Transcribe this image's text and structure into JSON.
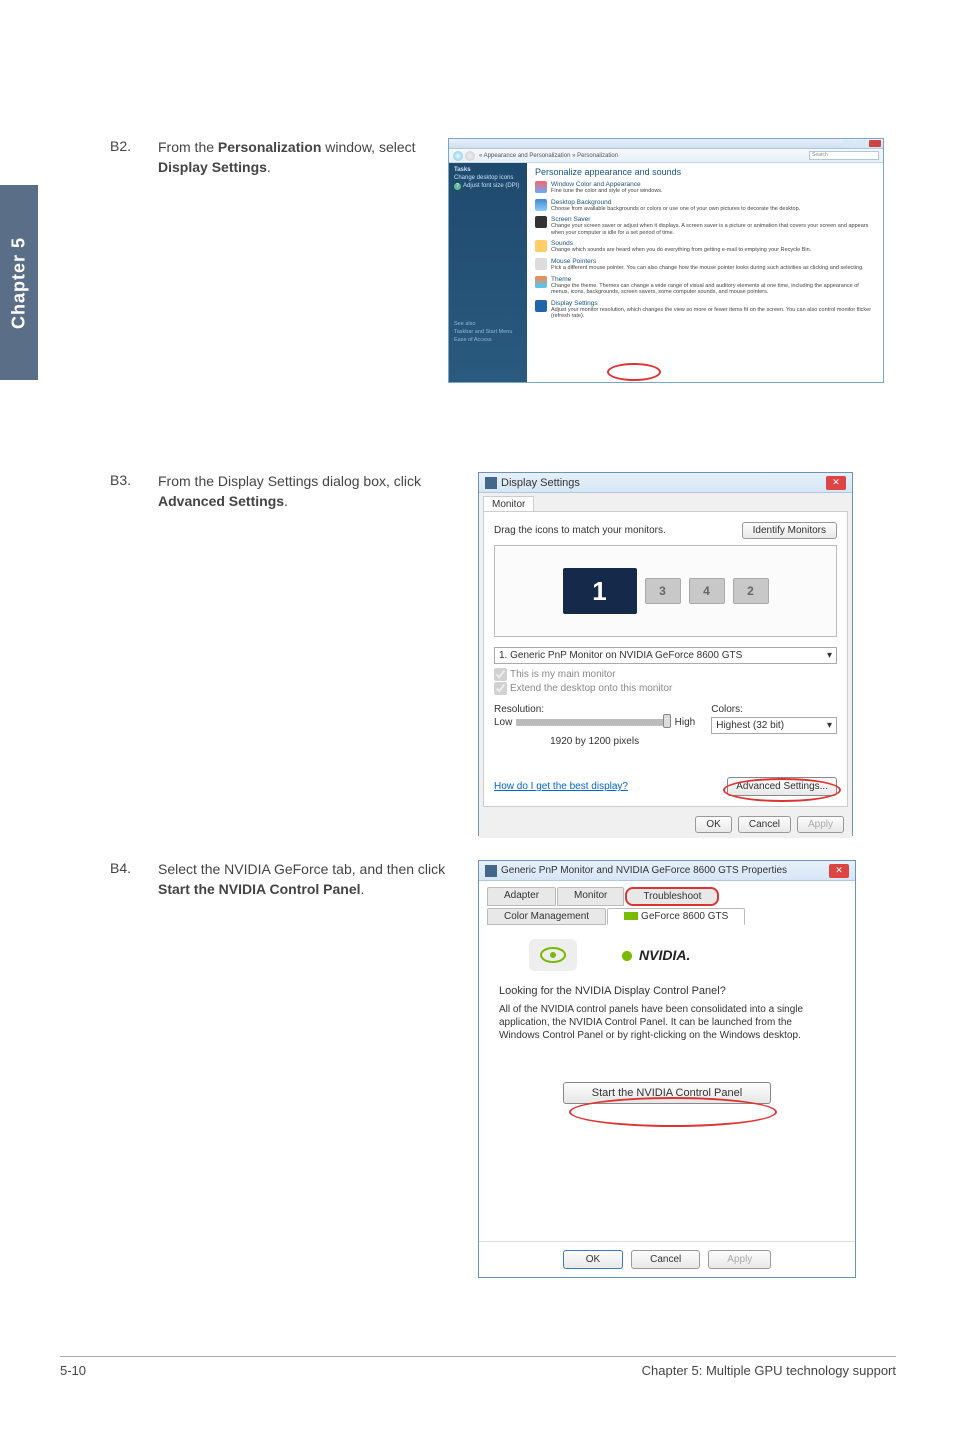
{
  "chapter_tab": "Chapter 5",
  "steps": {
    "b2": {
      "label": "B2.",
      "text_pre": "From the ",
      "text_bold1": "Personalization",
      "text_mid": " window, select ",
      "text_bold2": "Display Settings",
      "text_end": "."
    },
    "b3": {
      "label": "B3.",
      "text_pre": "From the Display Settings dialog box, click ",
      "text_bold1": "Advanced Settings",
      "text_end": "."
    },
    "b4": {
      "label": "B4.",
      "text_pre": "Select the NVIDIA GeForce tab, and then click ",
      "text_bold1": "Start the NVIDIA Control Panel",
      "text_end": "."
    }
  },
  "personalization": {
    "breadcrumb": "« Appearance and Personalization » Personalization",
    "search_placeholder": "Search",
    "sidebar": {
      "tasks": "Tasks",
      "items": [
        "Change desktop icons",
        "Adjust font size (DPI)"
      ],
      "see_also": [
        "See also",
        "Taskbar and Start Menu",
        "Ease of Access"
      ]
    },
    "heading": "Personalize appearance and sounds",
    "items": [
      {
        "title": "Window Color and Appearance",
        "desc": "Fine tune the color and style of your windows."
      },
      {
        "title": "Desktop Background",
        "desc": "Choose from available backgrounds or colors or use one of your own pictures to decorate the desktop."
      },
      {
        "title": "Screen Saver",
        "desc": "Change your screen saver or adjust when it displays. A screen saver is a picture or animation that covers your screen and appears when your computer is idle for a set period of time."
      },
      {
        "title": "Sounds",
        "desc": "Change which sounds are heard when you do everything from getting e-mail to emptying your Recycle Bin."
      },
      {
        "title": "Mouse Pointers",
        "desc": "Pick a different mouse pointer. You can also change how the mouse pointer looks during such activities as clicking and selecting."
      },
      {
        "title": "Theme",
        "desc": "Change the theme. Themes can change a wide range of visual and auditory elements at one time, including the appearance of menus, icons, backgrounds, screen savers, some computer sounds, and mouse pointers."
      },
      {
        "title": "Display Settings",
        "desc": "Adjust your monitor resolution, which changes the view so more or fewer items fit on the screen. You can also control monitor flicker (refresh rate)."
      }
    ]
  },
  "display_settings": {
    "title": "Display Settings",
    "tab": "Monitor",
    "drag_text": "Drag the icons to match your monitors.",
    "identify_btn": "Identify Monitors",
    "monitors": {
      "main": "1",
      "others": [
        "3",
        "4",
        "2"
      ]
    },
    "selector": "1. Generic PnP Monitor on NVIDIA GeForce 8600 GTS",
    "chk_main": "This is my main monitor",
    "chk_extend": "Extend the desktop onto this monitor",
    "resolution_label": "Resolution:",
    "low": "Low",
    "high": "High",
    "res_value": "1920 by 1200 pixels",
    "colors_label": "Colors:",
    "colors_value": "Highest (32 bit)",
    "help_link": "How do I get the best display?",
    "advanced_btn": "Advanced Settings...",
    "ok": "OK",
    "cancel": "Cancel",
    "apply": "Apply"
  },
  "props": {
    "title": "Generic PnP Monitor and NVIDIA GeForce 8600 GTS Properties",
    "tabs_row1": [
      "Adapter",
      "Monitor",
      "Troubleshoot"
    ],
    "tabs_row2_left": "Color Management",
    "tabs_row2_active": "GeForce 8600 GTS",
    "nvidia_brand": "NVIDIA.",
    "question": "Looking for the NVIDIA Display Control Panel?",
    "desc": "All of the NVIDIA control panels have been consolidated into a single application, the NVIDIA Control Panel. It can be launched from the Windows Control Panel or by right-clicking on the Windows desktop.",
    "start_btn": "Start the NVIDIA Control Panel",
    "ok": "OK",
    "cancel": "Cancel",
    "apply": "Apply"
  },
  "footer": {
    "left": "5-10",
    "right": "Chapter 5: Multiple GPU technology support"
  }
}
